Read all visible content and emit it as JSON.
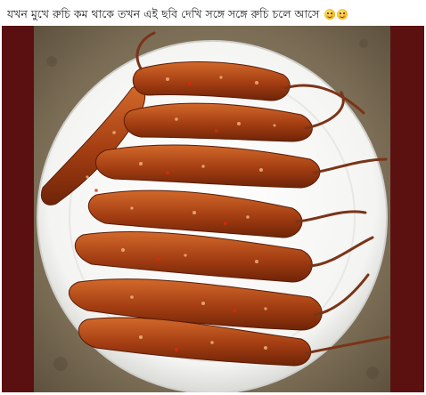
{
  "post": {
    "caption": "যখন মুখে রুচি কম থাকে তখন এই ছবি দেখি সঙ্গে সঙ্গে রুচি চলে আসে",
    "emojis": [
      "grinning-face",
      "grinning-face"
    ]
  },
  "photo": {
    "subject": "tamarind-pickle-plate-icon",
    "colors": {
      "background_frame": "#5a1010",
      "ground": "#8b7d63",
      "plate": "#ffffff",
      "pickle": "#b4471a"
    }
  }
}
